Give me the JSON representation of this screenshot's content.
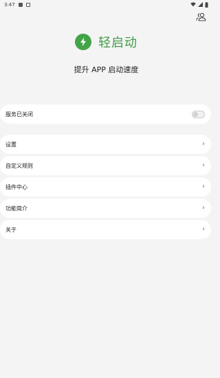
{
  "status_bar": {
    "time": "3:47",
    "left_icons": [
      "image-notification-icon",
      "a-notification-icon"
    ],
    "right_icons": [
      "wifi-icon",
      "signal-icon",
      "battery-icon"
    ]
  },
  "header": {
    "app_name": "轻启动",
    "subtitle": "提升 APP 启动速度",
    "logo_icon": "lightning-bolt-icon",
    "account_icon": "account-switch-icon",
    "brand_color": "#43a447"
  },
  "service": {
    "label": "服务已关闭",
    "enabled": false
  },
  "menu": {
    "items": [
      {
        "label": "设置"
      },
      {
        "label": "自定义规则"
      },
      {
        "label": "插件中心"
      },
      {
        "label": "功能简介"
      },
      {
        "label": "关于"
      }
    ],
    "chevron": "›"
  }
}
